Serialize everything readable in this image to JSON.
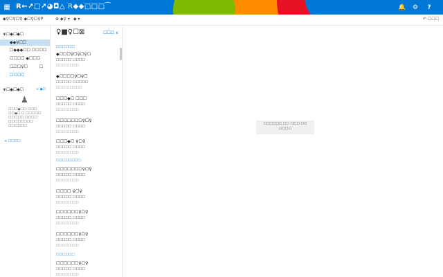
{
  "topbar": {
    "waffle_icon": "waffle-icon",
    "app_title": "R←↗□↗◕◘△",
    "app_sub": "R◆◆□□□⁀",
    "bell_icon": "bell-icon",
    "gear_icon": "gear-icon",
    "help_label": "?",
    "accent": "#0078d7"
  },
  "cmdbar": {
    "search_label": "◆♀☐♀☐♀ ◆☐♀☐♀Ρ",
    "new_label": "⊕ ◆♀ ▾",
    "mark_label": "◆ ▾",
    "undo_label": "↶ ☐☐☐"
  },
  "leftnav": {
    "fav_head": "∨☐◆☐◆☐",
    "items": [
      {
        "label": "◆◆♀☐☐",
        "count": ""
      },
      {
        "label": "☐◆◆◆☐☐ ☐☐☐☐",
        "count": ""
      },
      {
        "label": "☐☐☐☐ ◆☐☐☐",
        "count": ""
      },
      {
        "label": "☐☐☐♀☐",
        "count": "☐"
      },
      {
        "label": "☐☐☐☐",
        "count": ""
      }
    ],
    "groups_head": "∨☐◆☐◆☐",
    "groups_add": "+ ◆☐",
    "groups_text": [
      "☐☐☐◆☐☐ ☐☐☐",
      "☐☐◆☐ ☐ ☐☐☐☐☐",
      "☐☐☐☐☐ ☐☐☐☐",
      "☐☐☐☐☐☐☐☐",
      "☐☐☐☐☐☐"
    ],
    "discover_label": "+ ☐☐☐☐"
  },
  "msglist": {
    "title": "♀■♀☐⊠",
    "filter": "☐☐☐ ∨",
    "groups": [
      "☐☐☐☐☐☐",
      "☐☐☐☐☐☐☐☐",
      "☐☐☐☐☐☐"
    ],
    "messages": [
      {
        "from": "◆☐☐☐♀☐♀☐♀☐",
        "subj": "☐☐☐☐☐ ☐☐☐☐",
        "prev": "☐☐☐ ☐☐☐☐",
        "date": "☐☐☐"
      },
      {
        "from": "◆☐☐☐☐♀☐♀☐",
        "subj": "☐☐☐☐☐ ☐☐☐☐☐",
        "prev": "☐☐☐ ☐☐☐☐☐",
        "date": "☐☐☐"
      },
      {
        "from": "☐☐☐◆☐ ☐☐☐",
        "subj": "☐☐☐☐☐ ☐☐☐☐",
        "prev": "☐☐☐ ☐☐☐☐",
        "date": "☐☐☐"
      },
      {
        "from": "☐☐☐☐☐☐☐♀☐♀",
        "subj": "☐☐☐☐☐ ☐☐☐☐",
        "prev": "☐☐☐ ☐☐☐☐",
        "date": "☐☐☐"
      },
      {
        "from": "☐☐☐◆☐ ♀☐♀",
        "subj": "☐☐☐☐☐ ☐☐☐☐",
        "prev": "☐☐☐ ☐☐☐☐",
        "date": "☐☐☐"
      },
      {
        "from": "☐☐☐☐☐☐☐♀☐♀",
        "subj": "☐☐☐☐☐ ☐☐☐☐",
        "prev": "☐☐☐ ☐☐☐☐",
        "date": "☐☐☐"
      },
      {
        "from": "☐☐☐☐ ♀☐♀",
        "subj": "☐☐☐☐☐ ☐☐☐☐",
        "prev": "☐☐☐ ☐☐☐☐",
        "date": "☐☐☐"
      },
      {
        "from": "☐☐☐☐☐☐♀☐♀",
        "subj": "☐☐☐☐☐ ☐☐☐☐",
        "prev": "☐☐☐ ☐☐☐☐",
        "date": "☐☐☐"
      },
      {
        "from": "☐☐☐☐☐☐♀☐♀",
        "subj": "☐☐☐☐☐ ☐☐☐☐",
        "prev": "☐☐☐ ☐☐☐☐",
        "date": "☐☐☐"
      },
      {
        "from": "☐☐☐☐☐☐♀☐♀",
        "subj": "☐☐☐☐☐ ☐☐☐☐",
        "prev": "☐☐☐ ☐☐☐☐",
        "date": "☐☐☐"
      }
    ]
  },
  "reading": {
    "empty_line1": "☐☐☐☐☐☐ ☐☐ ☐☐☐ ☐☐",
    "empty_line2": "☐☐☐☐"
  }
}
